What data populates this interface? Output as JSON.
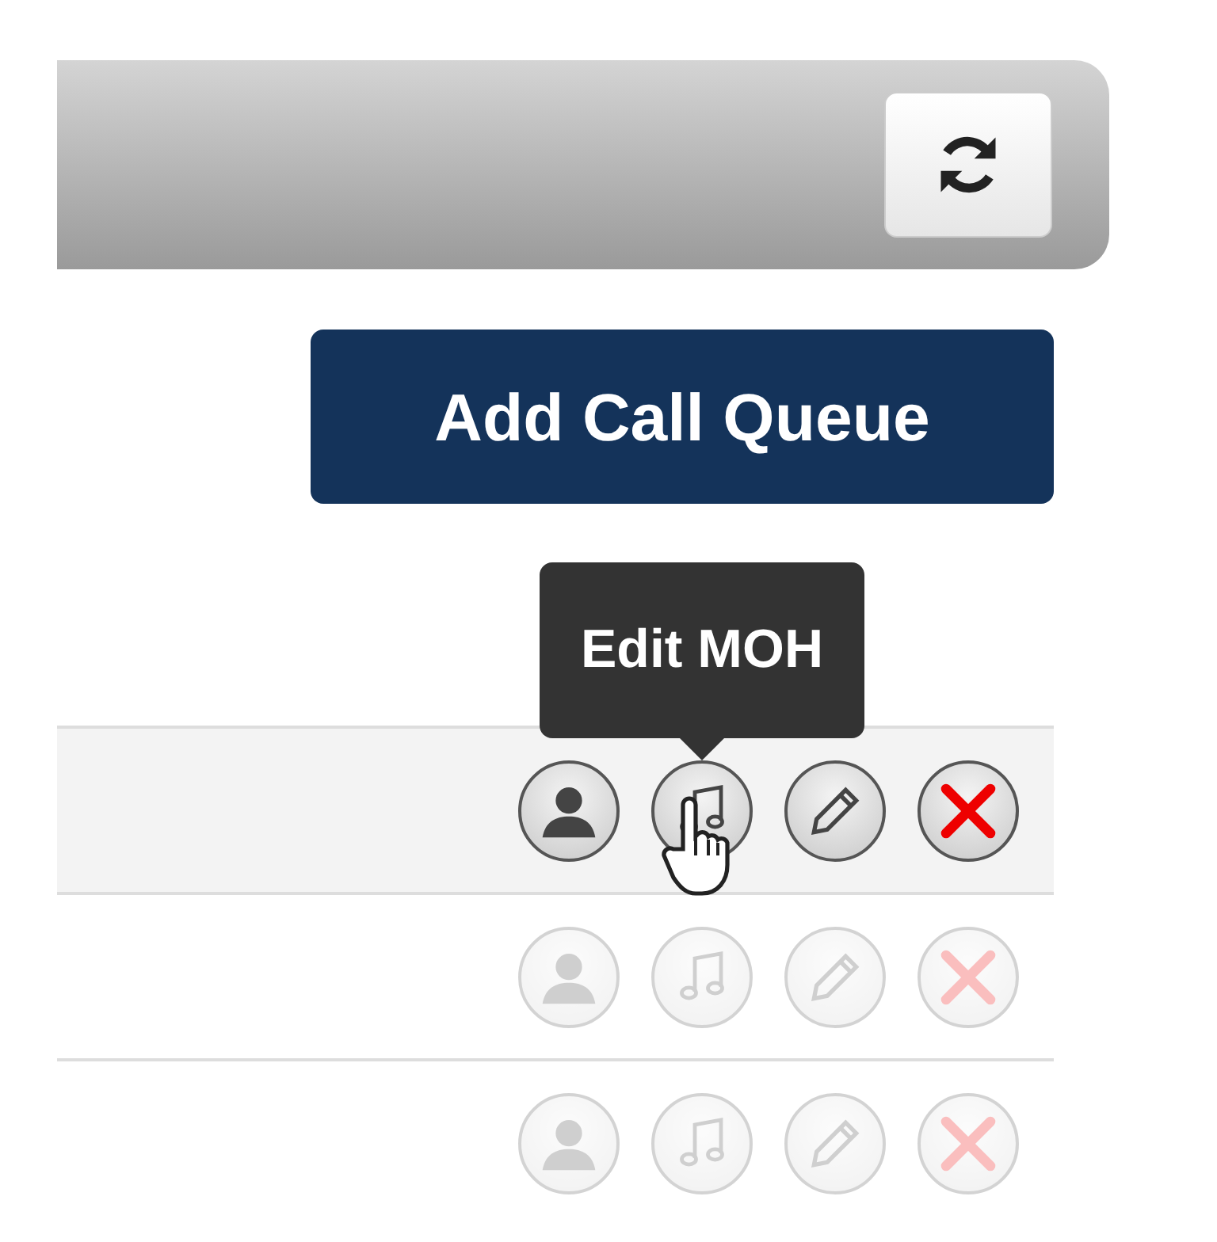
{
  "add_button": {
    "label": "Add Call Queue"
  },
  "rows": [
    {
      "active": true,
      "actions": [
        {
          "kind": "agents"
        },
        {
          "kind": "moh",
          "tooltip": "Edit MOH"
        },
        {
          "kind": "edit"
        },
        {
          "kind": "delete"
        }
      ]
    },
    {
      "active": false,
      "actions": [
        {
          "kind": "agents"
        },
        {
          "kind": "moh"
        },
        {
          "kind": "edit"
        },
        {
          "kind": "delete"
        }
      ]
    },
    {
      "active": false,
      "actions": [
        {
          "kind": "agents"
        },
        {
          "kind": "moh"
        },
        {
          "kind": "edit"
        },
        {
          "kind": "delete"
        }
      ]
    }
  ]
}
